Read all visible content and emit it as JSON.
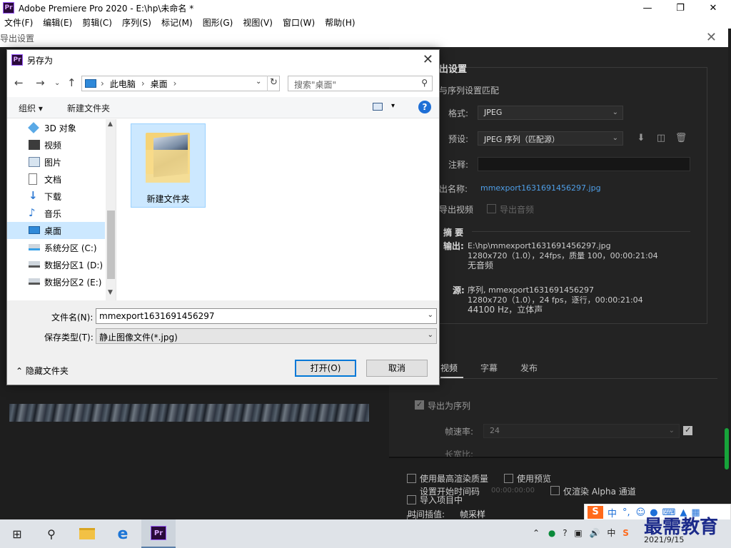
{
  "premiere": {
    "title": "Adobe Premiere Pro 2020 - E:\\hp\\未命名 *",
    "logo": "Pr",
    "menu": [
      "文件(F)",
      "编辑(E)",
      "剪辑(C)",
      "序列(S)",
      "标记(M)",
      "图形(G)",
      "视图(V)",
      "窗口(W)",
      "帮助(H)"
    ]
  },
  "export_dialog": {
    "title": "导出设置",
    "section_title": "出设置",
    "match_sequence": "与序列设置匹配",
    "format_label": "格式:",
    "format_value": "JPEG",
    "preset_label": "预设:",
    "preset_value": "JPEG 序列（匹配源）",
    "comment_label": "注释:",
    "output_name_label": "出名称:",
    "output_name_value": "mmexport1631691456297.jpg",
    "export_video": "导出视频",
    "export_audio": "导出音频",
    "summary_title": "摘 要",
    "output_label": "输出:",
    "output_lines": [
      "E:\\hp\\mmexport1631691456297.jpg",
      "1280x720（1.0），24fps，质量 100，00:00:21:04",
      "无音频"
    ],
    "source_label": "源:",
    "source_lines": [
      "序列, mmexport1631691456297",
      "1280x720（1.0），24 fps，逐行，00:00:21:04",
      "44100 Hz，立体声"
    ],
    "tabs": [
      "视频",
      "字幕",
      "发布"
    ],
    "export_as_sequence": "导出为序列",
    "frame_rate_label": "帧速率:",
    "frame_rate_value": "24",
    "aspect_label": "长宽比:",
    "max_render_quality": "使用最高渲染质量",
    "use_preview": "使用预览",
    "import_into_project": "导入项目中",
    "set_start_timecode": "设置开始时间码",
    "start_timecode_value": "00:00:00:00",
    "render_alpha_only": "仅渲染 Alpha 通道",
    "time_interpolation_label": "时间插值:",
    "time_interpolation_value": "帧采样"
  },
  "save_as": {
    "title": "另存为",
    "icon": "Pr",
    "address": [
      "此电脑",
      "桌面"
    ],
    "search_placeholder": "搜索\"桌面\"",
    "organize": "组织",
    "new_folder": "新建文件夹",
    "nav_items": [
      {
        "label": "3D 对象",
        "icon": "3d-objects-icon"
      },
      {
        "label": "视频",
        "icon": "video-icon"
      },
      {
        "label": "图片",
        "icon": "pictures-icon"
      },
      {
        "label": "文档",
        "icon": "documents-icon"
      },
      {
        "label": "下载",
        "icon": "download-icon"
      },
      {
        "label": "音乐",
        "icon": "music-icon"
      },
      {
        "label": "桌面",
        "icon": "desktop-icon",
        "selected": true
      },
      {
        "label": "系统分区 (C:)",
        "icon": "drive-icon"
      },
      {
        "label": "数据分区1 (D:)",
        "icon": "drive-icon"
      },
      {
        "label": "数据分区2 (E:)",
        "icon": "drive-icon"
      }
    ],
    "folder_name": "新建文件夹",
    "filename_label": "文件名(N):",
    "filename_value": "mmexport1631691456297",
    "filetype_label": "保存类型(T):",
    "filetype_value": "静止图像文件(*.jpg)",
    "hide_folders": "隐藏文件夹",
    "open_button": "打开(O)",
    "cancel_button": "取消"
  },
  "taskbar": {
    "date": "2021/9/15",
    "ime_text": "中"
  },
  "watermark": "最需教育",
  "colors": {
    "premiere_purple": "#9b5cff",
    "link_blue": "#4f9fe8",
    "selection_blue": "#cce8ff",
    "default_button_border": "#0078d7"
  }
}
